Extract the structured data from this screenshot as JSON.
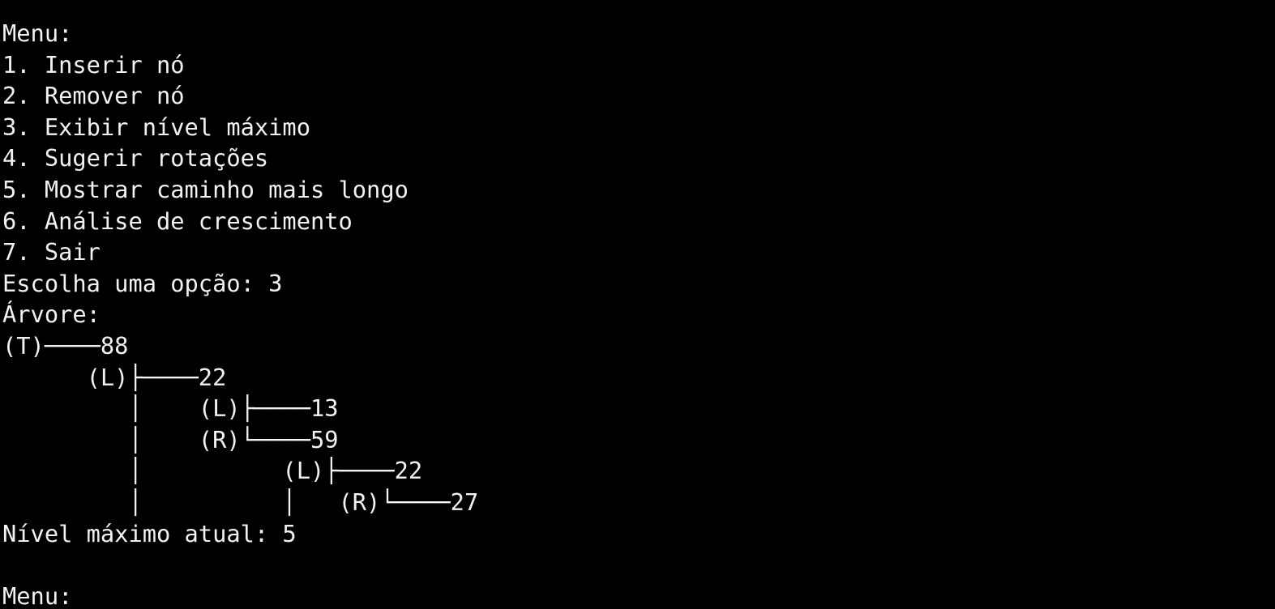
{
  "terminal": {
    "lines": [
      "Menu:",
      "1. Inserir nó",
      "2. Remover nó",
      "3. Exibir nível máximo",
      "4. Sugerir rotações",
      "5. Mostrar caminho mais longo",
      "6. Análise de crescimento",
      "7. Sair",
      "Escolha uma opção: 3",
      "Árvore:",
      "(T)────88",
      "      (L)├────22",
      "         │    (L)├────13",
      "         │    (R)└────59",
      "         │          (L)├────22",
      "         │          │   (R)└────27",
      "Nível máximo atual: 5",
      "",
      "Menu:"
    ]
  }
}
